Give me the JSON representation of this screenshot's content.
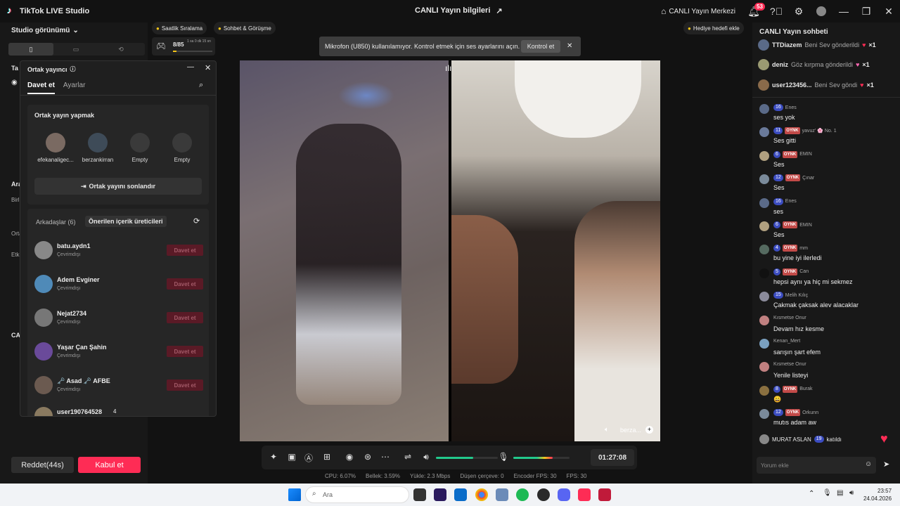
{
  "titlebar": {
    "app_name": "TikTok LIVE Studio",
    "center_title": "CANLI Yayın bilgileri",
    "live_center": "CANLI Yayın Merkezi",
    "notif_count": "53"
  },
  "left": {
    "studio_view": "Studio görünümü",
    "reject_label": "Reddet(44s)",
    "accept_label": "Kabul et",
    "fragments": [
      "Ta",
      "Ara",
      "Birl",
      "Orta",
      "Etki",
      "CA"
    ]
  },
  "pills": {
    "hourly": "Saatlik Sıralama",
    "chat_meet": "Sohbet & Görüşme",
    "goal_progress": "8/85",
    "goal_time": "1 sa 0 dk 15 sn",
    "gift_goal": "Hediye hedefi ekle",
    "goal_fraction": 0.094
  },
  "toast": {
    "message": "Mikrofon (U850) kullanılamıyor. Kontrol etmek için ses ayarlarını açın.",
    "action": "Kontrol et"
  },
  "cohost": {
    "title": "Ortak yayıncı",
    "tab_invite": "Davet et",
    "tab_settings": "Ayarlar",
    "section_title": "Ortak yayın yapmak",
    "slots": [
      "efekanaligec...",
      "berzankirran",
      "Empty",
      "Empty"
    ],
    "end_button": "Ortak yayını sonlandır",
    "tab_friends": "Arkadaşlar (6)",
    "tab_suggested": "Önerilen içerik üreticileri",
    "invite_label": "Davet et",
    "friends": [
      {
        "name": "batu.aydn1",
        "status": "Çevrimdışı"
      },
      {
        "name": "Adem Evginer",
        "status": "Çevrimdışı"
      },
      {
        "name": "Nejat2734",
        "status": "Çevrimdışı"
      },
      {
        "name": "Yaşar Çan Şahin",
        "status": "Çevrimdışı"
      },
      {
        "name": "🗝️ Asad 🗝️ AFBE",
        "status": "Çevrimdışı"
      },
      {
        "name": "user190764528",
        "status": "4"
      }
    ]
  },
  "stage": {
    "right_label": "berza..."
  },
  "controls": {
    "timer": "01:27:08",
    "volume_level": 0.6,
    "mic_level": 0.7
  },
  "stats": {
    "cpu": "CPU: 6.07%",
    "memory": "Bellek: 3.59%",
    "upload": "Yükle: 2.3 Mbps",
    "dropped": "Düşen çerçeve: 0",
    "encoder_fps": "Encoder FPS: 30",
    "fps": "FPS: 30"
  },
  "chat": {
    "title": "CANLI Yayın sohbeti",
    "gifts": [
      {
        "user": "TTDiazem",
        "action": "Beni Sev gönderildi",
        "count": "×1"
      },
      {
        "user": "deniz",
        "action": "Göz kırpma gönderildi",
        "count": "×1"
      },
      {
        "user": "user123456...",
        "action": "Beni Sev göndi",
        "count": "×1"
      }
    ],
    "messages": [
      {
        "level": "16",
        "fan": "",
        "user": "Enes",
        "text": "ses yok"
      },
      {
        "level": "11",
        "fan": "OYNK",
        "user": "yavuz' 🌸 No. 1",
        "text": "Ses gitti"
      },
      {
        "level": "6",
        "fan": "OYNK",
        "user": "EMIN",
        "text": "Ses"
      },
      {
        "level": "12",
        "fan": "OYNK",
        "user": "Çınar",
        "text": "Ses"
      },
      {
        "level": "16",
        "fan": "",
        "user": "Enes",
        "text": "ses"
      },
      {
        "level": "6",
        "fan": "OYNK",
        "user": "EMIN",
        "text": "Ses"
      },
      {
        "level": "4",
        "fan": "OYNK",
        "user": "mm",
        "text": "bu yine iyi ilerledi"
      },
      {
        "level": "5",
        "fan": "OYNK",
        "user": "Can",
        "text": "hepsi aynı ya hiç mi sekmez"
      },
      {
        "level": "15",
        "fan": "",
        "user": "Melih Kılıç",
        "text": "Çakmak çaksak alev alacaklar"
      },
      {
        "level": "",
        "fan": "",
        "user": "Kısmetse Onur",
        "text": "Devam hız kesme"
      },
      {
        "level": "",
        "fan": "",
        "user": "Kenan_Mert",
        "text": "sarışın şart efem"
      },
      {
        "level": "",
        "fan": "",
        "user": "Kısmetse Onur",
        "text": "Yenile listeyi"
      },
      {
        "level": "8",
        "fan": "OYNK",
        "user": "Burak",
        "text": "😄"
      },
      {
        "level": "12",
        "fan": "OYNK",
        "user": "Orkunn",
        "text": "mutıs adam aw"
      }
    ],
    "join": {
      "user": "MURAT ASLAN",
      "level": "19",
      "text": "katıldı"
    },
    "input_placeholder": "Yorum ekle"
  },
  "taskbar": {
    "search": "Ara",
    "time": "23:57",
    "date": "24.04.2026"
  }
}
